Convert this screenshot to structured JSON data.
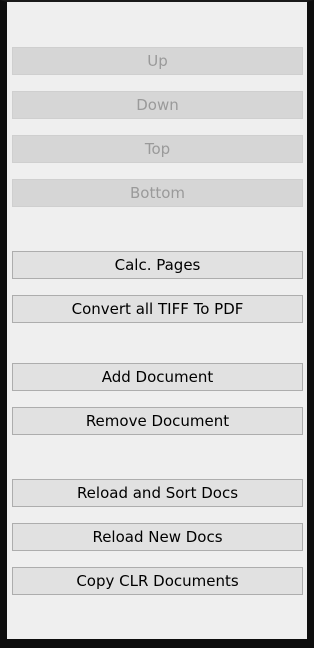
{
  "buttons": {
    "up": "Up",
    "down": "Down",
    "top": "Top",
    "bottom": "Bottom",
    "calc_pages": "Calc. Pages",
    "convert_tiff": "Convert all TIFF To PDF",
    "add_document": "Add Document",
    "remove_document": "Remove Document",
    "reload_sort": "Reload and Sort Docs",
    "reload_new": "Reload New Docs",
    "copy_clr": "Copy CLR Documents"
  },
  "states": {
    "up": "disabled",
    "down": "disabled",
    "top": "disabled",
    "bottom": "disabled"
  },
  "colors": {
    "panel_background": "#efefef",
    "button_background": "#e1e1e1",
    "button_border": "#adadad",
    "disabled_background": "#d6d6d6",
    "disabled_text": "#9a9a9a",
    "frame_border": "#0d0d0d"
  }
}
